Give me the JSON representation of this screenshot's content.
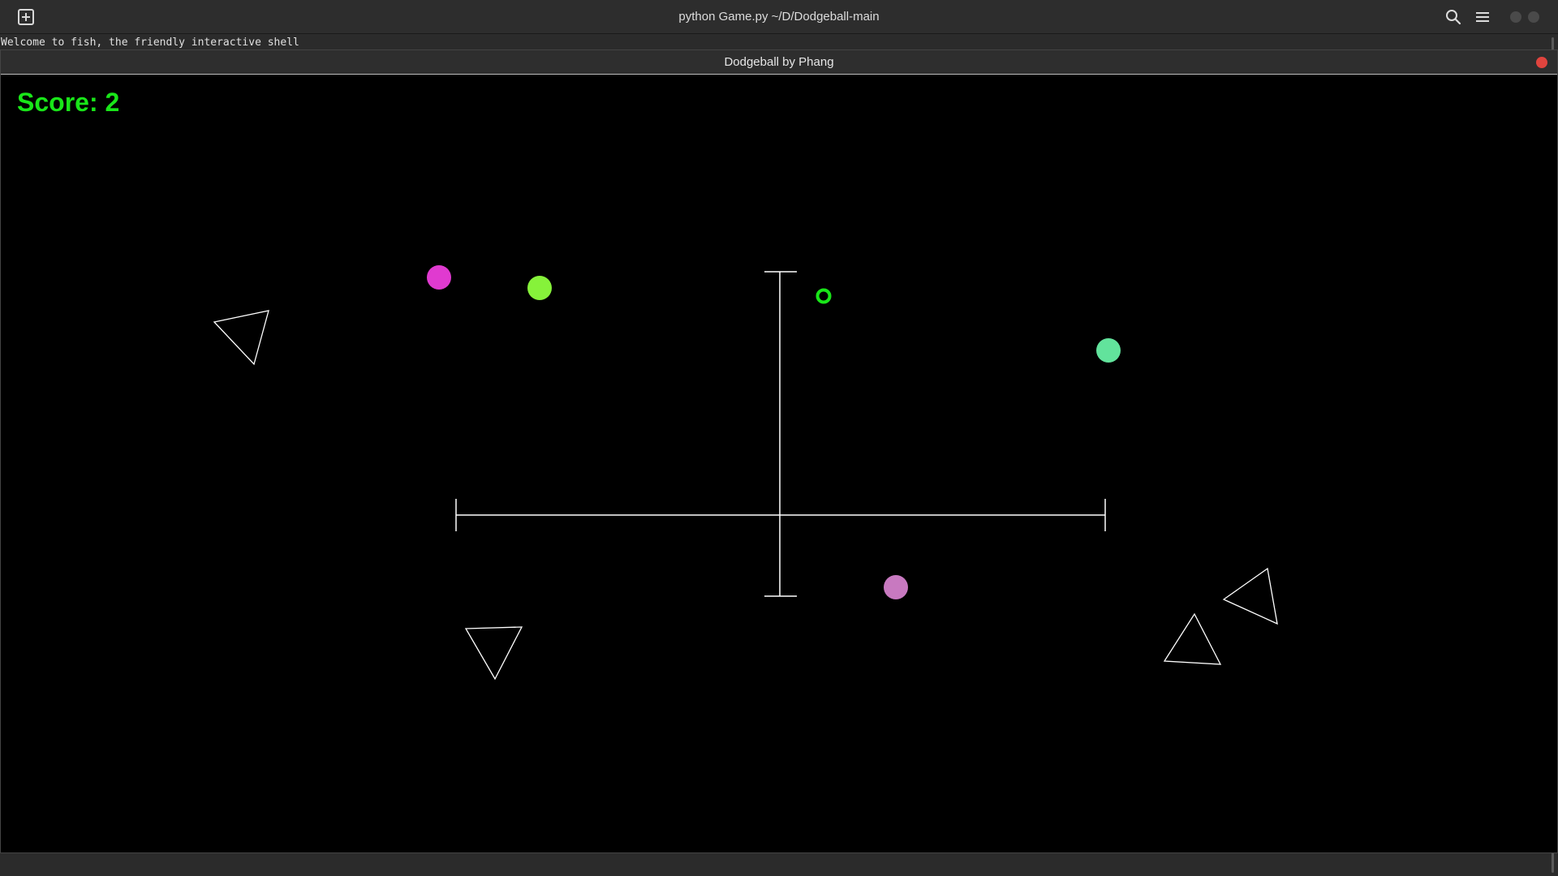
{
  "terminal": {
    "title": "python Game.py ~/D/Dodgeball-main",
    "welcome_line": "Welcome to fish, the friendly interactive shell"
  },
  "game_window": {
    "title": "Dodgeball by Phang",
    "score_label": "Score: 2",
    "score": 2
  },
  "colors": {
    "score_text": "#19e619",
    "ball_magenta": "#e03ad0",
    "ball_lime": "#86f23a",
    "ball_mint": "#62e39c",
    "ball_pink": "#c879c0",
    "player_ring": "#19e619",
    "lines": "#ffffff",
    "close_button": "#e0443e"
  },
  "icons": {
    "new_tab": "new-tab-icon",
    "search": "search-icon",
    "menu": "hamburger-menu-icon"
  }
}
